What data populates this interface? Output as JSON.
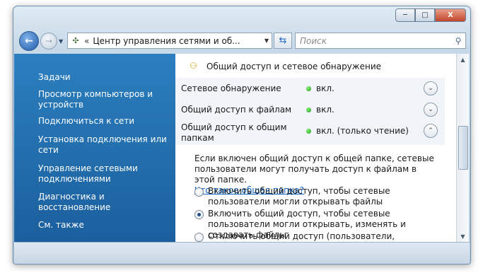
{
  "window": {
    "caption": {
      "minimize": "─",
      "maximize": "□",
      "close": "X"
    }
  },
  "toolbar": {
    "address_path": "Центр управления сетями и об...",
    "address_chevron": "«",
    "search_placeholder": "Поиск"
  },
  "sidebar": {
    "heading": "Задачи",
    "items": [
      {
        "label": "Просмотр компьютеров и устройств"
      },
      {
        "label": "Подключиться к сети"
      },
      {
        "label": "Установка подключения или сети"
      },
      {
        "label": "Управление сетевыми подключениями"
      },
      {
        "label": "Диагностика и восстановление"
      }
    ],
    "see_also": "См. также"
  },
  "section": {
    "title": "Общий доступ и сетевое обнаружение",
    "rows": [
      {
        "label": "Сетевое обнаружение",
        "value": "вкл.",
        "state": "collapsed"
      },
      {
        "label": "Общий доступ к файлам",
        "value": "вкл.",
        "state": "collapsed"
      },
      {
        "label": "Общий доступ к общим папкам",
        "value": "вкл. (только чтение)",
        "state": "expanded"
      }
    ],
    "status_color": "#1c9a12",
    "detail": {
      "description": "Если включен общий доступ к общей папке, сетевые пользователи могут получать доступ к файлам в этой папке.",
      "help_link": "Что такое общая папка?",
      "options": [
        {
          "label": "Включить общий доступ, чтобы сетевые пользователи могли открывать файлы",
          "selected": false
        },
        {
          "label": "Включить общий доступ, чтобы сетевые пользователи могли открывать, изменять и создавать файлы",
          "selected": true
        },
        {
          "label": "Отключить общий доступ (пользователи, выполнившие вход на этот компьютер, будут иметь доступ к общим",
          "selected": false
        }
      ]
    }
  },
  "colors": {
    "sidebar": "#2374b6",
    "accent_link": "#0a64c8"
  }
}
